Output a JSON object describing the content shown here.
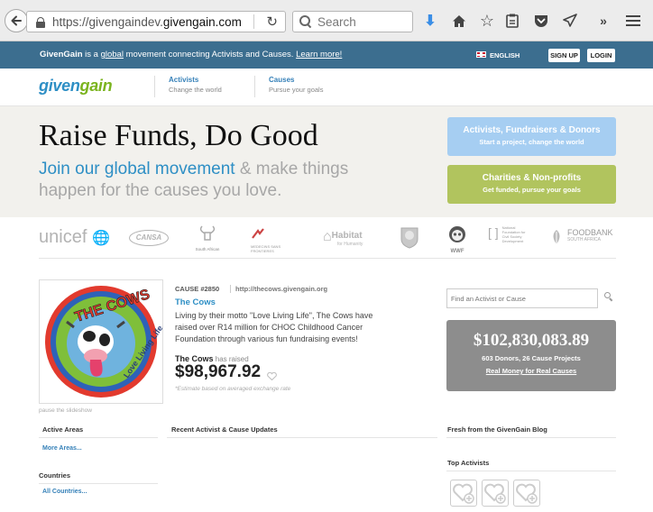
{
  "browser": {
    "url_prefix": "https://givengaindev.",
    "url_domain": "givengain.com",
    "search_placeholder": "Search"
  },
  "topbar": {
    "brand": "GivenGain",
    "msg_a": " is a ",
    "msg_global": "global",
    "msg_b": " movement connecting Activists and Causes. ",
    "learn_more": "Learn more!",
    "language": "ENGLISH",
    "signup": "SIGN UP",
    "login": "LOGIN"
  },
  "header": {
    "logo_a": "given",
    "logo_b": "gain",
    "nav": [
      {
        "title": "Activists",
        "sub": "Change the world"
      },
      {
        "title": "Causes",
        "sub": "Pursue your goals"
      }
    ]
  },
  "hero": {
    "title": "Raise Funds, Do Good",
    "sub_highlight": "Join our global movement",
    "sub_rest": " & make things happen for the causes you love.",
    "cta_activists": {
      "title": "Activists, Fundraisers & Donors",
      "sub": "Start a project, change the world"
    },
    "cta_charities": {
      "title": "Charities & Non-profits",
      "sub": "Get funded, pursue your goals"
    }
  },
  "partners": {
    "unicef": "unicef",
    "cansa": "CANSA",
    "sanparks": "South African",
    "msf": "MEDECINS SANS FRONTIERES",
    "habitat": "Habitat",
    "habitat_sub": "for Humanity",
    "wwf": "WWF",
    "nfcsd": "National Foundation for Civil Society Development",
    "foodbank": "FOODBANK",
    "foodbank_sub": "SOUTH AFRICA"
  },
  "feature": {
    "image_text": "THE COWS",
    "image_text2": "Love Living Life",
    "pause": "pause the slideshow",
    "cause_num": "CAUSE #2850",
    "cause_url": "http://thecows.givengain.org",
    "name": "The Cows",
    "description": "Living by their motto \"Love Living Life\", The Cows have raised over R14 million for CHOC Childhood Cancer Foundation through various fun fundraising events!",
    "raised_who": "The Cows",
    "raised_label": " has raised",
    "raised_amount": "$98,967.92",
    "estimate_note": "*Estimate based on averaged exchange rate"
  },
  "sidebar": {
    "find_placeholder": "Find an Activist or Cause",
    "total": "$102,830,083.89",
    "counts": "603 Donors, 26 Cause Projects",
    "real_money": "Real Money for Real Causes"
  },
  "sections": {
    "active_areas": "Active Areas",
    "more_areas": "More Areas...",
    "countries": "Countries",
    "all_countries": "All Countries...",
    "recent": "Recent Activist & Cause Updates",
    "blog": "Fresh from the GivenGain Blog",
    "top_activists": "Top Activists"
  },
  "colors": {
    "topbar": "#3c6e8f",
    "brand_blue": "#2e8fc5",
    "brand_green": "#7bb41f",
    "cta_blue": "#a6cef2",
    "cta_green": "#b1c45e",
    "stats_grey": "#8d8d8d"
  }
}
